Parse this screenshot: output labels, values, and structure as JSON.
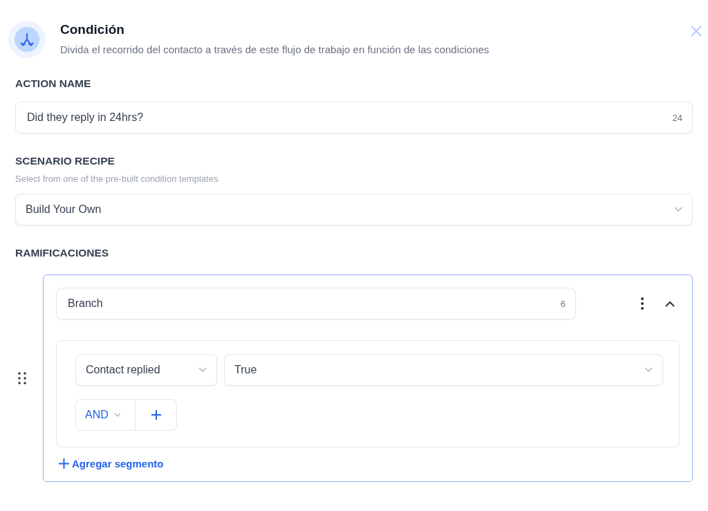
{
  "header": {
    "title": "Condición",
    "subtitle": "Divida el recorrido del contacto a través de este flujo de trabajo en función de las condiciones"
  },
  "action_name": {
    "label": "ACTION NAME",
    "value": "Did they reply in 24hrs?",
    "count": "24"
  },
  "scenario_recipe": {
    "label": "SCENARIO RECIPE",
    "hint": "Select from one of the pre-built condition templates",
    "value": "Build Your Own"
  },
  "branches": {
    "label": "RAMIFICACIONES",
    "items": [
      {
        "name": "Branch",
        "count": "6",
        "expanded": true,
        "conditions": [
          {
            "field": "Contact replied",
            "value": "True"
          }
        ],
        "operator": "AND",
        "add_segment": "Agregar segmento"
      }
    ]
  }
}
